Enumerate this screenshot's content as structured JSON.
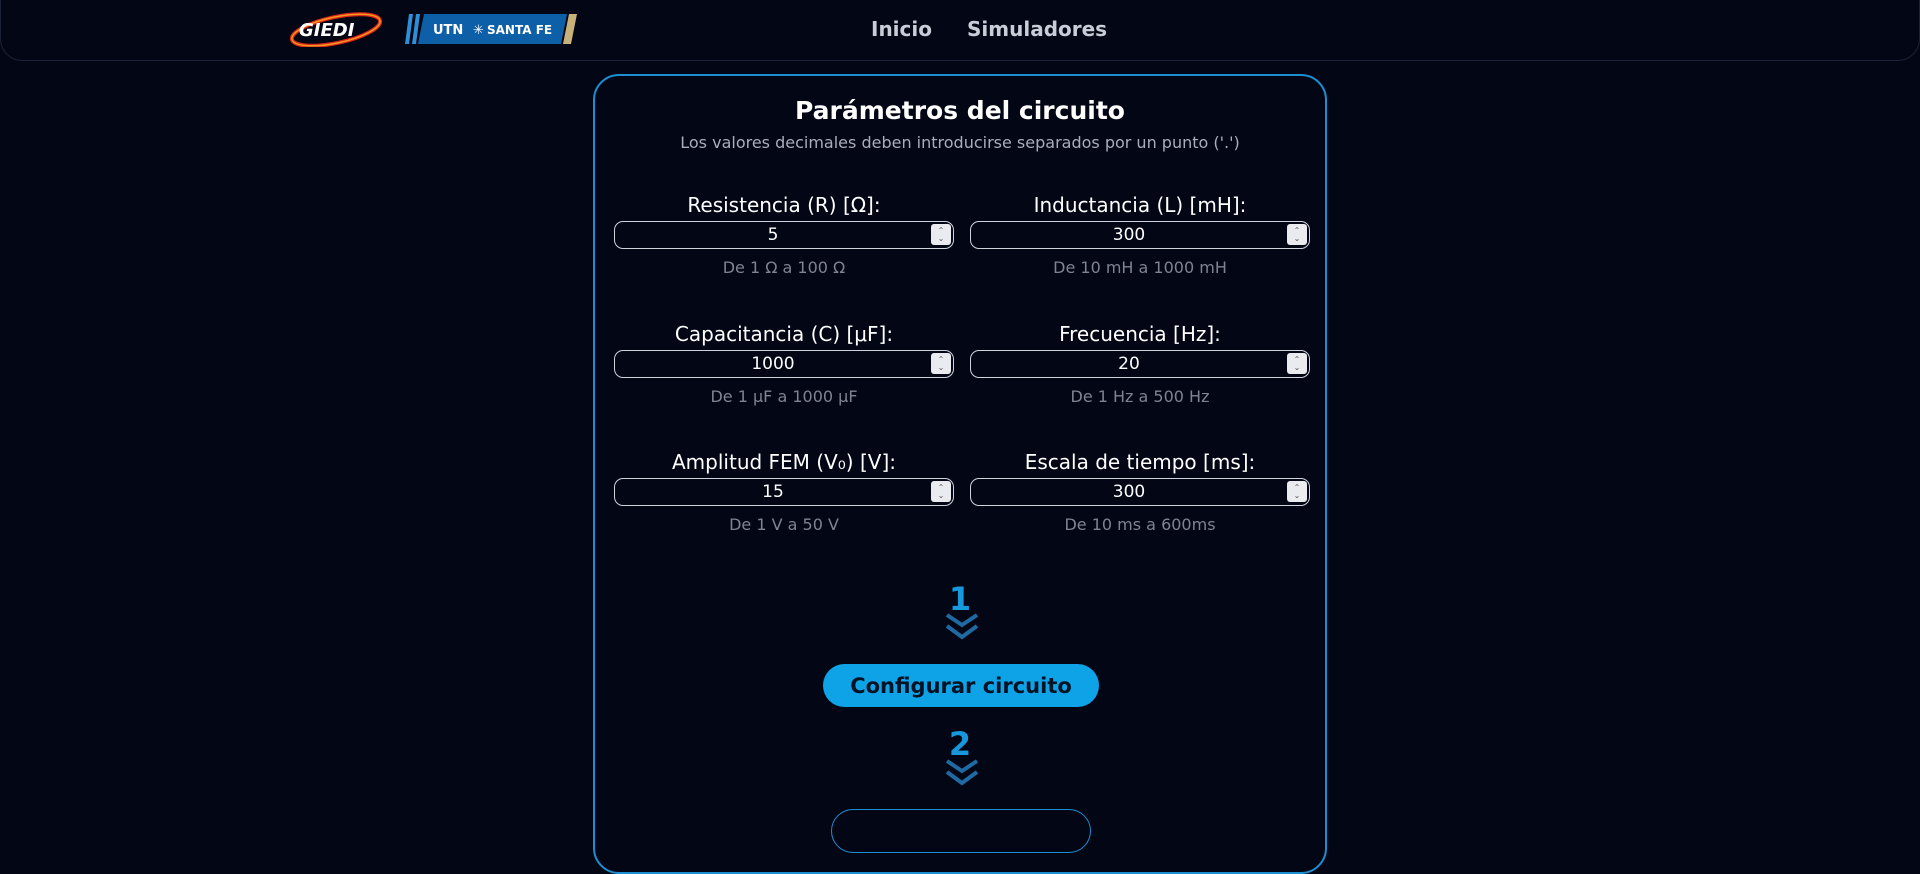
{
  "navbar": {
    "logo_giedi_text": "GIEDI",
    "logo_utn_text": "UTN",
    "logo_utn_subtext": "SANTA FE",
    "links": [
      "Inicio",
      "Simuladores"
    ]
  },
  "card": {
    "title": "Parámetros del circuito",
    "subtitle": "Los valores decimales deben introducirse separados por un punto ('.')",
    "fields": [
      {
        "label": "Resistencia (R) [Ω]:",
        "value": "5",
        "hint": "De 1 Ω a 100 Ω"
      },
      {
        "label": "Inductancia (L) [mH]:",
        "value": "300",
        "hint": "De 10 mH a 1000 mH"
      },
      {
        "label": "Capacitancia (C) [μF]:",
        "value": "1000",
        "hint": "De 1 μF a 1000 μF"
      },
      {
        "label": "Frecuencia [Hz]:",
        "value": "20",
        "hint": "De 1 Hz a 500 Hz"
      },
      {
        "label": "Amplitud FEM (V₀) [V]:",
        "value": "15",
        "hint": "De 1 V a 50 V"
      },
      {
        "label": "Escala de tiempo [ms]:",
        "value": "300",
        "hint": "De 10 ms a 600ms"
      }
    ],
    "step1": "1",
    "step2": "2",
    "config_button": "Configurar circuito"
  },
  "colors": {
    "background": "#030615",
    "accent": "#1b8fd2",
    "button": "#0ea3e6",
    "hint_text": "#7e8494"
  },
  "icons": [
    "spinner-arrows-icon",
    "chevron-double-down-icon"
  ]
}
